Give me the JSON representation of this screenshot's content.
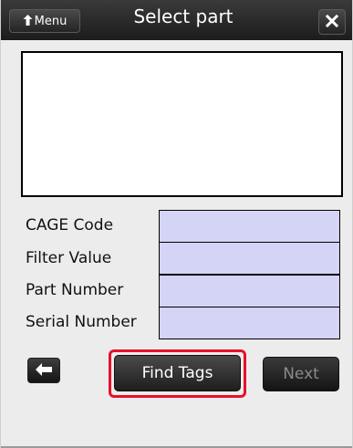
{
  "header": {
    "menu_label": "Menu",
    "title": "Select part"
  },
  "fields": [
    {
      "label": "CAGE Code",
      "value": ""
    },
    {
      "label": "Filter Value",
      "value": ""
    },
    {
      "label": "Part Number",
      "value": ""
    },
    {
      "label": "Serial Number",
      "value": ""
    }
  ],
  "buttons": {
    "find_tags": "Find Tags",
    "next": "Next"
  },
  "colors": {
    "titlebar": "#2a2a2a",
    "input_fill": "#d4d4f6",
    "highlight": "#e8102a",
    "disabled_text": "#8a8a8a"
  }
}
